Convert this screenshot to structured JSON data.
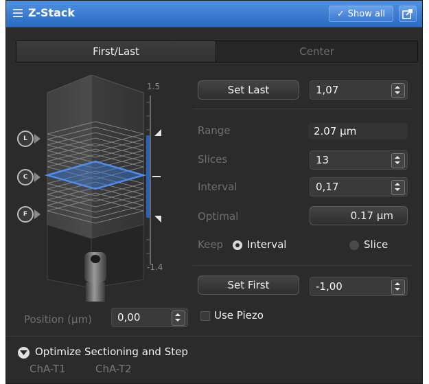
{
  "panel": {
    "title": "Z-Stack",
    "show_all": "Show all"
  },
  "tabs": [
    {
      "label": "First/Last",
      "active": true
    },
    {
      "label": "Center",
      "active": false
    }
  ],
  "scale": {
    "top": "1.5",
    "bottom": "-1.4"
  },
  "markers": {
    "last": "L",
    "center": "C",
    "first": "F"
  },
  "set_last": {
    "label": "Set Last",
    "value": "1,07"
  },
  "range": {
    "label": "Range",
    "value": "2.07 µm"
  },
  "slices": {
    "label": "Slices",
    "value": "13"
  },
  "interval": {
    "label": "Interval",
    "value": "0,17"
  },
  "optimal": {
    "label": "Optimal",
    "value": "0.17 µm"
  },
  "keep": {
    "label": "Keep",
    "options": [
      "Interval",
      "Slice"
    ],
    "selected": "Interval"
  },
  "set_first": {
    "label": "Set First",
    "value": "-1,00"
  },
  "position": {
    "label": "Position (µm)",
    "value": "0,00"
  },
  "use_piezo": {
    "label": "Use Piezo",
    "checked": false
  },
  "optimize": {
    "label": "Optimize Sectioning and Step"
  },
  "channels": [
    "ChA-T1",
    "ChA-T2"
  ],
  "colors": {
    "accent": "#2a6bc4",
    "highlight": "#3a7ad8",
    "range_bar": "#2c5fb8"
  }
}
